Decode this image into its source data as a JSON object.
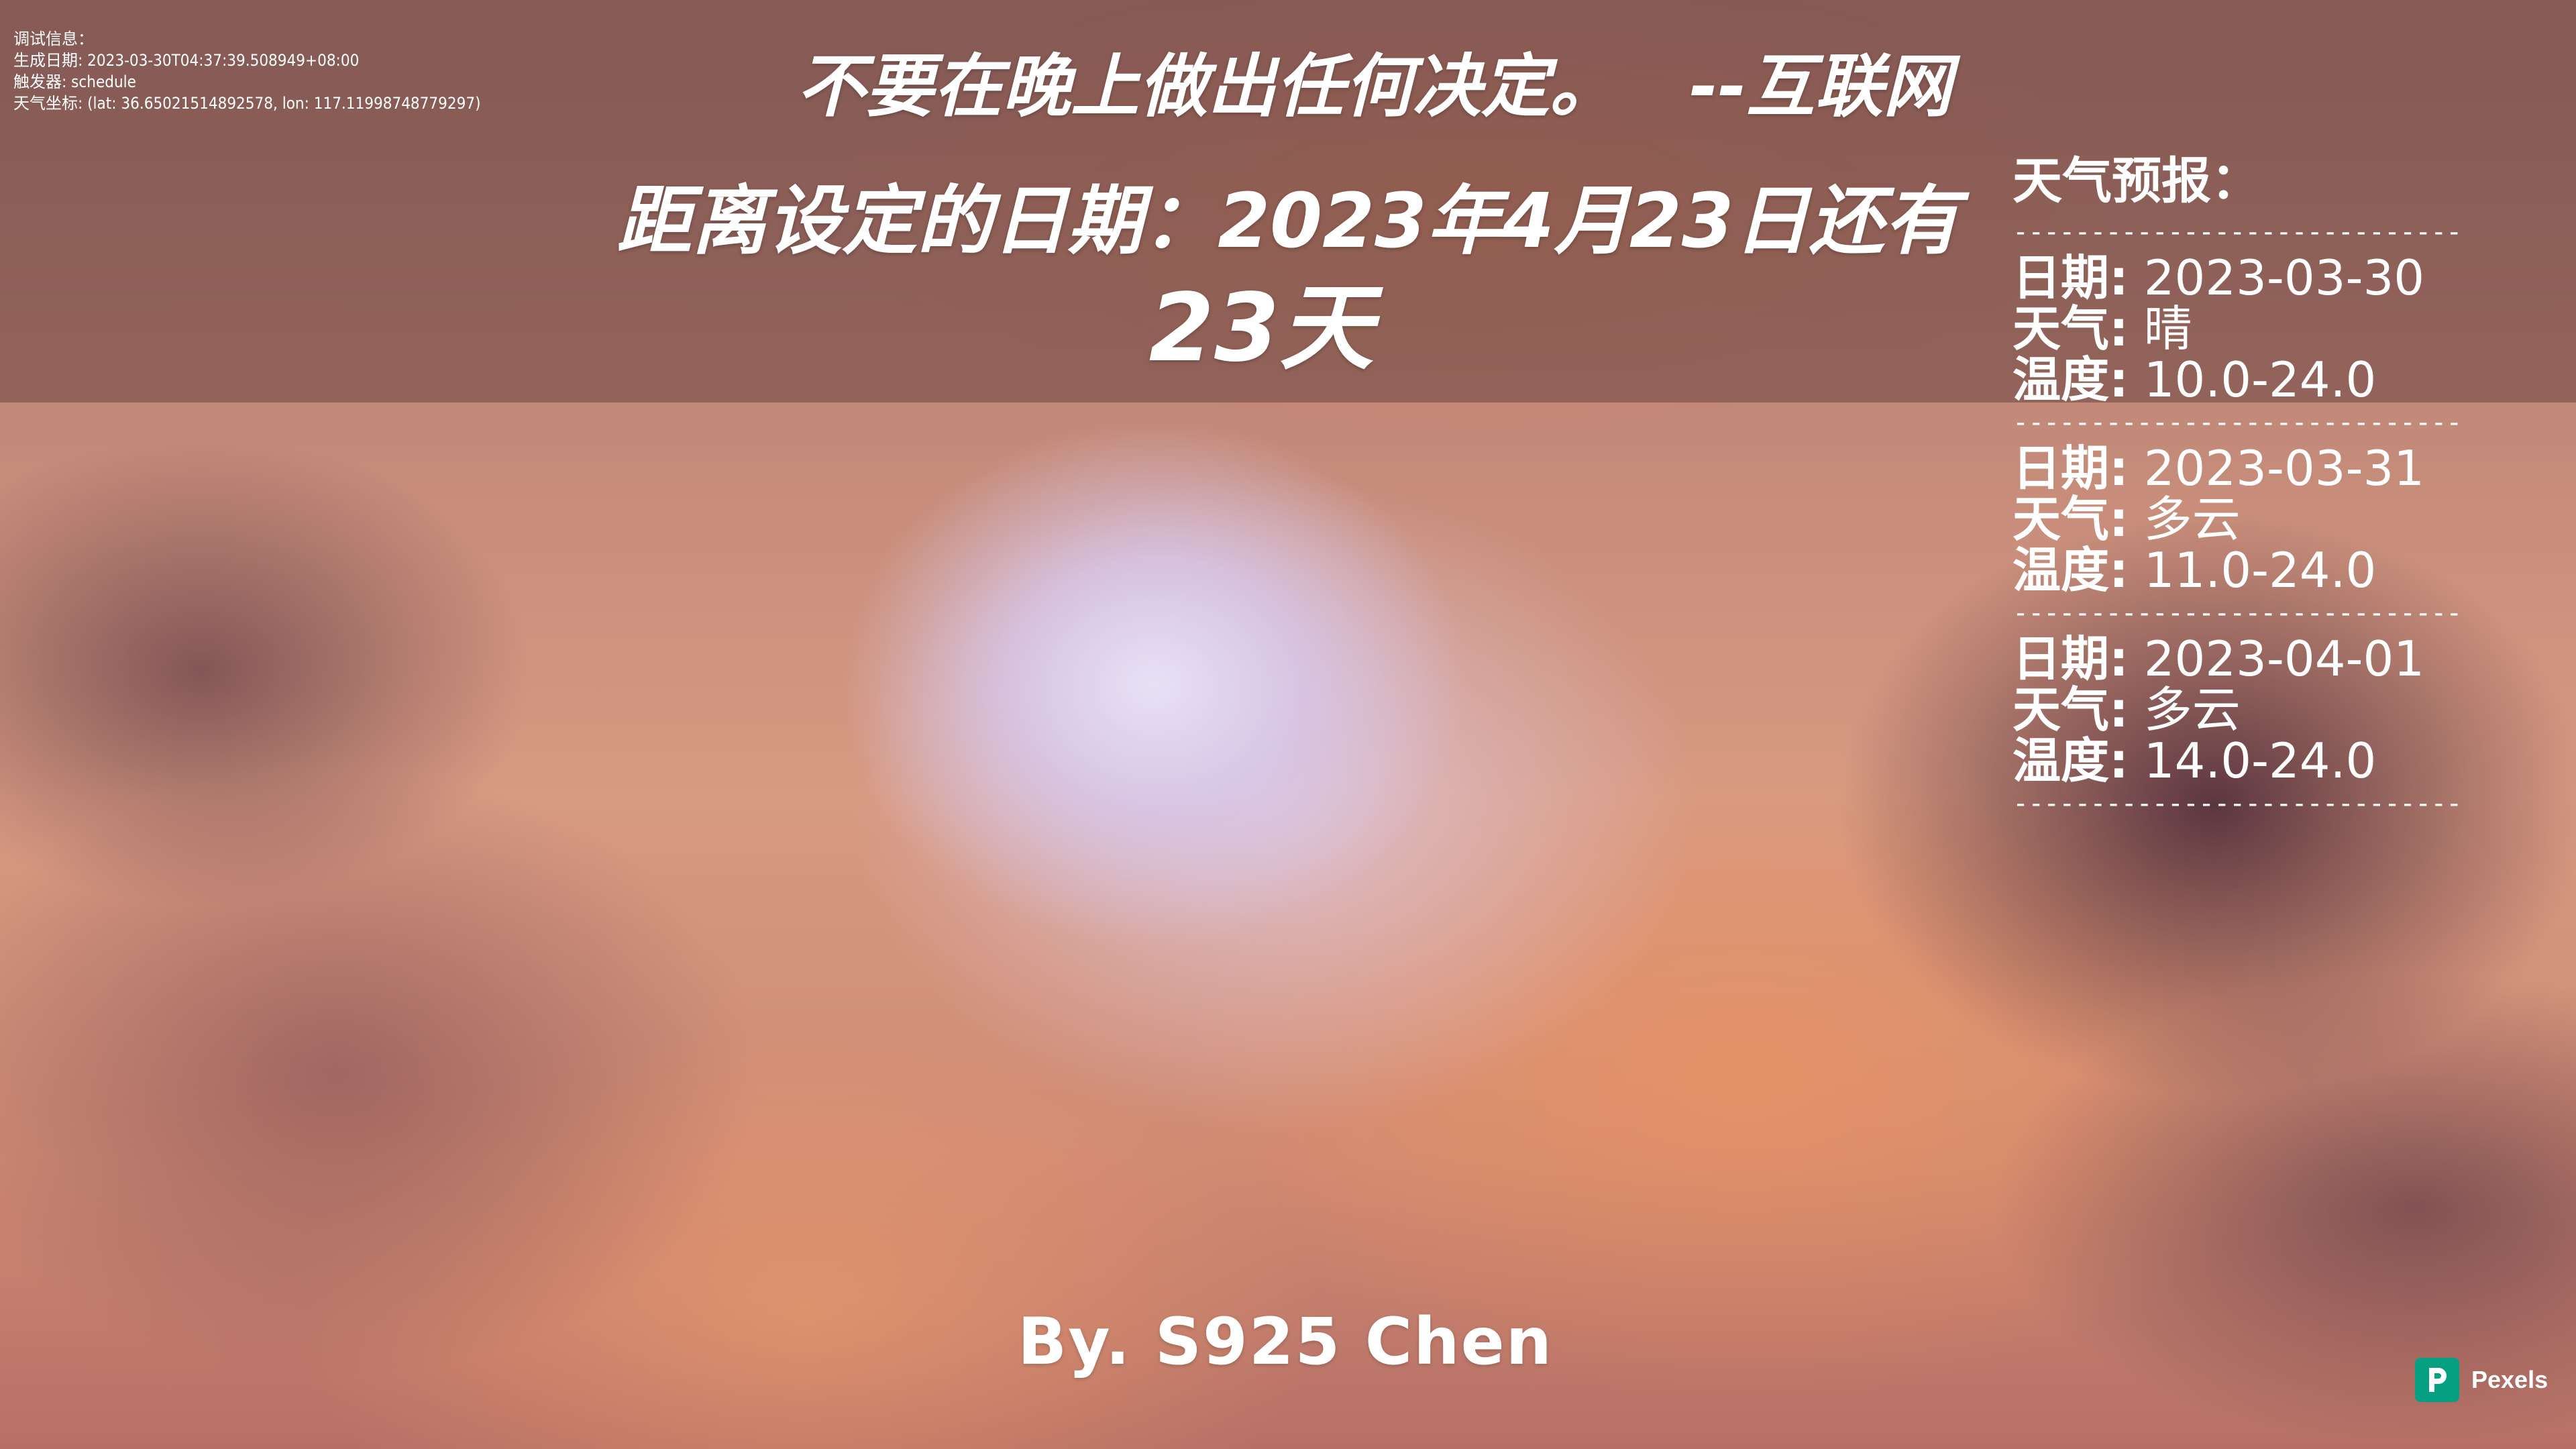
{
  "debug": {
    "title": "调试信息：",
    "generated": "生成日期: 2023-03-30T04:37:39.508949+08:00",
    "trigger": "触发器: schedule",
    "coords": "天气坐标: (lat: 36.65021514892578, lon: 117.11998748779297)"
  },
  "quote": {
    "text": "不要在晚上做出任何决定。",
    "source": "--互联网"
  },
  "countdown": {
    "line1": "距离设定的日期：2023年4月23日还有",
    "line2": "23天"
  },
  "forecast": {
    "title": "天气预报：",
    "divider": "-----------------------------",
    "days": [
      {
        "date_label": "日期:",
        "date": "2023-03-30",
        "weather_label": "天气:",
        "weather": "晴",
        "temp_label": "温度:",
        "temp": "10.0-24.0"
      },
      {
        "date_label": "日期:",
        "date": "2023-03-31",
        "weather_label": "天气:",
        "weather": "多云",
        "temp_label": "温度:",
        "temp": "11.0-24.0"
      },
      {
        "date_label": "日期:",
        "date": "2023-04-01",
        "weather_label": "天气:",
        "weather": "多云",
        "temp_label": "温度:",
        "temp": "14.0-24.0"
      }
    ]
  },
  "author": "By. S925 Chen",
  "watermark": {
    "label": "Pexels",
    "color": "#05a081"
  }
}
